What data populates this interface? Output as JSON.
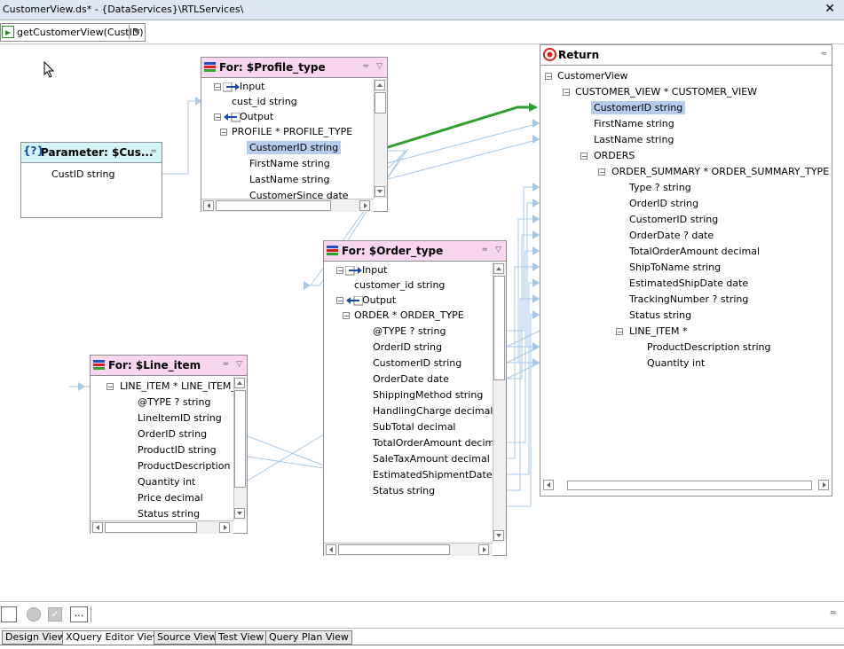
{
  "window": {
    "title": "CustomerView.ds* - {DataServices}\\RTLServices\\",
    "close_glyph": "✕"
  },
  "function_selector": {
    "value": "getCustomerView(CustID)",
    "icon": "function-arrow-icon"
  },
  "parameter_box": {
    "title": "Parameter: $Cus...",
    "badge": "{?}",
    "fields": [
      "CustID  string"
    ]
  },
  "profile_box": {
    "title": "For: $Profile_type",
    "input_label": "Input",
    "input_fields": [
      "cust_id  string"
    ],
    "output_label": "Output",
    "element": "PROFILE * PROFILE_TYPE",
    "fields": [
      "CustomerID  string",
      "FirstName  string",
      "LastName  string",
      "CustomerSince  date"
    ],
    "selected_field": "CustomerID  string"
  },
  "order_box": {
    "title": "For: $Order_type",
    "input_label": "Input",
    "input_fields": [
      "customer_id  string"
    ],
    "output_label": "Output",
    "element": "ORDER * ORDER_TYPE",
    "fields": [
      "@TYPE ?  string",
      "OrderID  string",
      "CustomerID  string",
      "OrderDate  date",
      "ShippingMethod  string",
      "HandlingCharge  decimal",
      "SubTotal  decimal",
      "TotalOrderAmount  decimal",
      "SaleTaxAmount  decimal",
      "EstimatedShipmentDate  dat",
      "Status  string"
    ]
  },
  "line_item_box": {
    "title": "For: $Line_item",
    "element": "LINE_ITEM * LINE_ITEM_",
    "fields": [
      "@TYPE ?  string",
      "LineItemID  string",
      "OrderID  string",
      "ProductID  string",
      "ProductDescription  str",
      "Quantity  int",
      "Price  decimal",
      "Status  string"
    ]
  },
  "return_box": {
    "title": "Return",
    "root": "CustomerView",
    "customer_view": "CUSTOMER_VIEW * CUSTOMER_VIEW",
    "customer_fields": [
      "CustomerID  string",
      "FirstName  string",
      "LastName  string"
    ],
    "selected_field": "CustomerID  string",
    "orders": "ORDERS",
    "order_summary": "ORDER_SUMMARY * ORDER_SUMMARY_TYPE",
    "order_summary_fields": [
      "Type ?  string",
      "OrderID  string",
      "CustomerID  string",
      "OrderDate ?  date",
      "TotalOrderAmount  decimal",
      "ShipToName  string",
      "EstimatedShipDate  date",
      "TrackingNumber ?  string",
      "Status  string"
    ],
    "line_item": "LINE_ITEM *",
    "line_item_fields": [
      "ProductDescription  string",
      "Quantity  int"
    ]
  },
  "status_bar": {
    "ellipsis": "..."
  },
  "tabs": [
    {
      "label": "Design View",
      "active": false
    },
    {
      "label": "XQuery Editor View",
      "active": true
    },
    {
      "label": "Source View",
      "active": false
    },
    {
      "label": "Test View",
      "active": false
    },
    {
      "label": "Query Plan View",
      "active": false
    }
  ],
  "colors": {
    "for_header": "#f9d6f0",
    "parameter_header": "#d4f3f7",
    "selection": "#b5cdea",
    "mapping_wire": "#a8c8e8",
    "active_wire": "#2ea02e",
    "return_icon": "#d82020"
  }
}
